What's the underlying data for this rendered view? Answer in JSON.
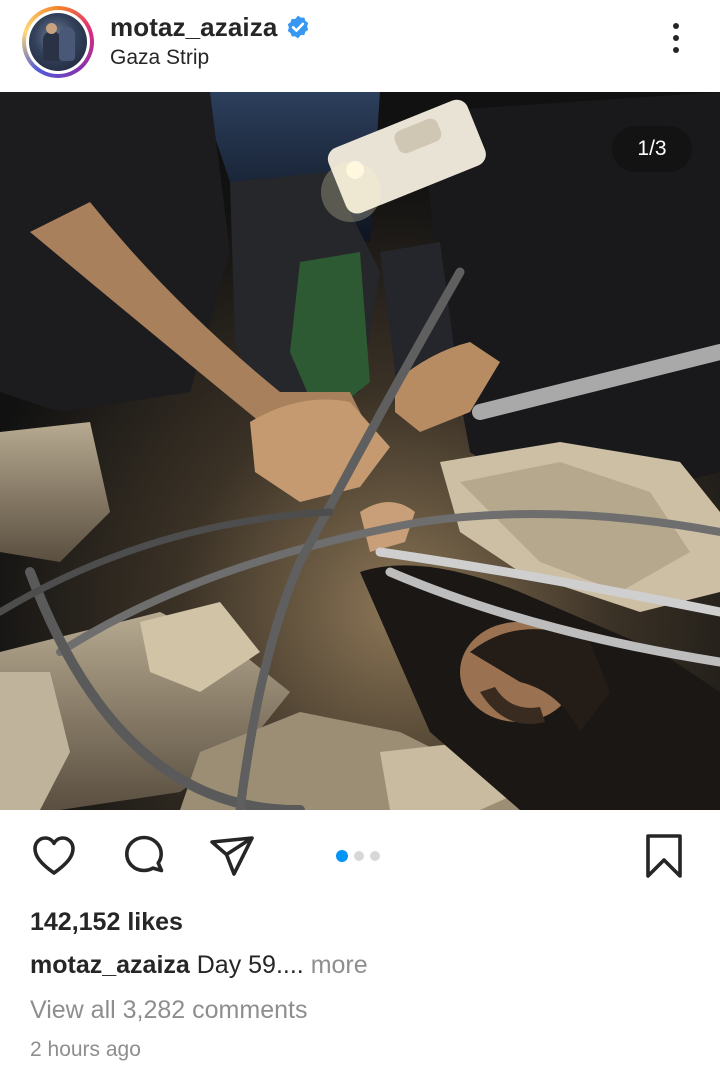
{
  "post": {
    "username": "motaz_azaiza",
    "verified": true,
    "location": "Gaza Strip",
    "image_counter": "1/3",
    "carousel": {
      "total": 3,
      "active_index": 0
    },
    "likes_count": "142,152",
    "likes_word": "likes",
    "caption_user": "motaz_azaiza",
    "caption_text": "Day 59....",
    "caption_more": " more",
    "comments_link": "View all 3,282 comments",
    "timestamp": "2 hours ago"
  },
  "icons": {
    "verified": "verified-badge-icon",
    "menu": "more-options-icon",
    "like": "heart-icon",
    "comment": "comment-bubble-icon",
    "share": "paper-plane-icon",
    "save": "bookmark-icon"
  },
  "colors": {
    "verified_blue": "#3897f0",
    "carousel_active": "#0095f6",
    "secondary_text": "#8e8e8e"
  }
}
